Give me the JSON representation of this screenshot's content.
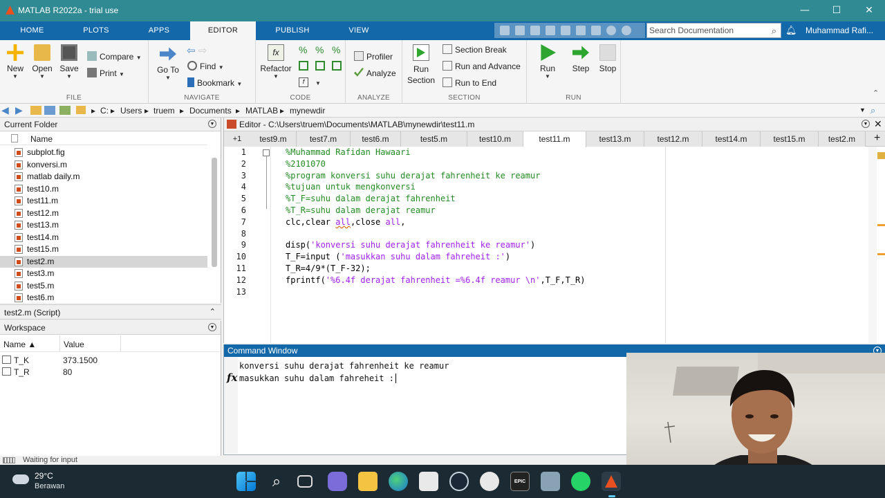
{
  "window": {
    "title": "MATLAB R2022a - trial use",
    "minimize": "—",
    "maximize": "☐",
    "close": "✕"
  },
  "ribbon_tabs": [
    "HOME",
    "PLOTS",
    "APPS",
    "EDITOR",
    "PUBLISH",
    "VIEW"
  ],
  "active_tab": "EDITOR",
  "search_placeholder": "Search Documentation",
  "user_name": "Muhammad Rafi...",
  "ribbon": {
    "file": {
      "label": "FILE",
      "new": "New",
      "open": "Open",
      "save": "Save",
      "compare": "Compare",
      "print": "Print"
    },
    "navigate": {
      "label": "NAVIGATE",
      "goto": "Go To",
      "find": "Find",
      "bookmark": "Bookmark"
    },
    "code": {
      "label": "CODE",
      "refactor": "Refactor"
    },
    "analyze": {
      "label": "ANALYZE",
      "profiler": "Profiler",
      "analyze": "Analyze"
    },
    "section": {
      "label": "SECTION",
      "run_section": "Run Section",
      "section_break": "Section Break",
      "run_and_advance": "Run and Advance",
      "run_to_end": "Run to End"
    },
    "run": {
      "label": "RUN",
      "run": "Run",
      "step": "Step",
      "stop": "Stop"
    }
  },
  "path": [
    "C:",
    "Users",
    "truem",
    "Documents",
    "MATLAB",
    "mynewdir"
  ],
  "current_folder": {
    "title": "Current Folder",
    "column": "Name",
    "files": [
      "subplot.fig",
      "konversi.m",
      "matlab daily.m",
      "test10.m",
      "test11.m",
      "test12.m",
      "test13.m",
      "test14.m",
      "test15.m",
      "test2.m",
      "test3.m",
      "test5.m",
      "test6.m"
    ],
    "selected": "test2.m"
  },
  "details": "test2.m  (Script)",
  "workspace": {
    "title": "Workspace",
    "columns": [
      "Name ▲",
      "Value"
    ],
    "rows": [
      {
        "name": "T_K",
        "value": "373.1500"
      },
      {
        "name": "T_R",
        "value": "80"
      }
    ]
  },
  "status_text": "Waiting for input",
  "editor": {
    "title": "Editor - C:\\Users\\truem\\Documents\\MATLAB\\mynewdir\\test11.m",
    "tabs_prefix": "+1",
    "tabs": [
      "test9.m",
      "test7.m",
      "test6.m",
      "test5.m",
      "test10.m",
      "test11.m",
      "test13.m",
      "test12.m",
      "test14.m",
      "test15.m",
      "test2.m"
    ],
    "active_tab": "test11.m",
    "line_numbers": [
      "1",
      "2",
      "3",
      "4",
      "5",
      "6",
      "7",
      "8",
      "9",
      "10",
      "11",
      "12",
      "13"
    ],
    "code": {
      "l1": "%Muhammad Rafidan Hawaari",
      "l2": "%2101070",
      "l3": "%program konversi suhu derajat fahrenheit ke reamur",
      "l4": "%tujuan untuk mengkonversi",
      "l5": "%T_F=suhu dalam derajat fahrenheit",
      "l6": "%T_R=suhu dalam derajat reamur",
      "l7a": "clc,clear ",
      "l7b": "all",
      "l7c": ",close ",
      "l7d": "all",
      "l7e": ",",
      "l9a": "disp(",
      "l9b": "'konversi suhu derajat fahrenheit ke reamur'",
      "l9c": ")",
      "l10a": "T_F=input (",
      "l10b": "'masukkan suhu dalam fahreheit :'",
      "l10c": ")",
      "l11": "T_R=4/9*(T_F-32);",
      "l12a": "fprintf(",
      "l12b": "'%6.4f derajat fahrenheit =%6.4f reamur \\n'",
      "l12c": ",T_F,T_R)"
    }
  },
  "command_window": {
    "title": "Command Window",
    "line1": "konversi suhu derajat fahrenheit ke reamur",
    "line2": "masukkan suhu dalam fahreheit :",
    "prompt_icon": "fx"
  },
  "taskbar": {
    "temperature": "29°C",
    "condition": "Berawan",
    "apps": [
      "windows-start",
      "search",
      "task-view",
      "teams-chat",
      "file-explorer",
      "edge",
      "store",
      "steam",
      "xbox",
      "epic-games",
      "app-generic",
      "whatsapp",
      "matlab"
    ]
  },
  "colors": {
    "titlebar": "#2f8a93",
    "tabbar": "#1268a8",
    "comment": "#228b22",
    "string": "#a020f0",
    "taskbar": "#1c2a33"
  }
}
